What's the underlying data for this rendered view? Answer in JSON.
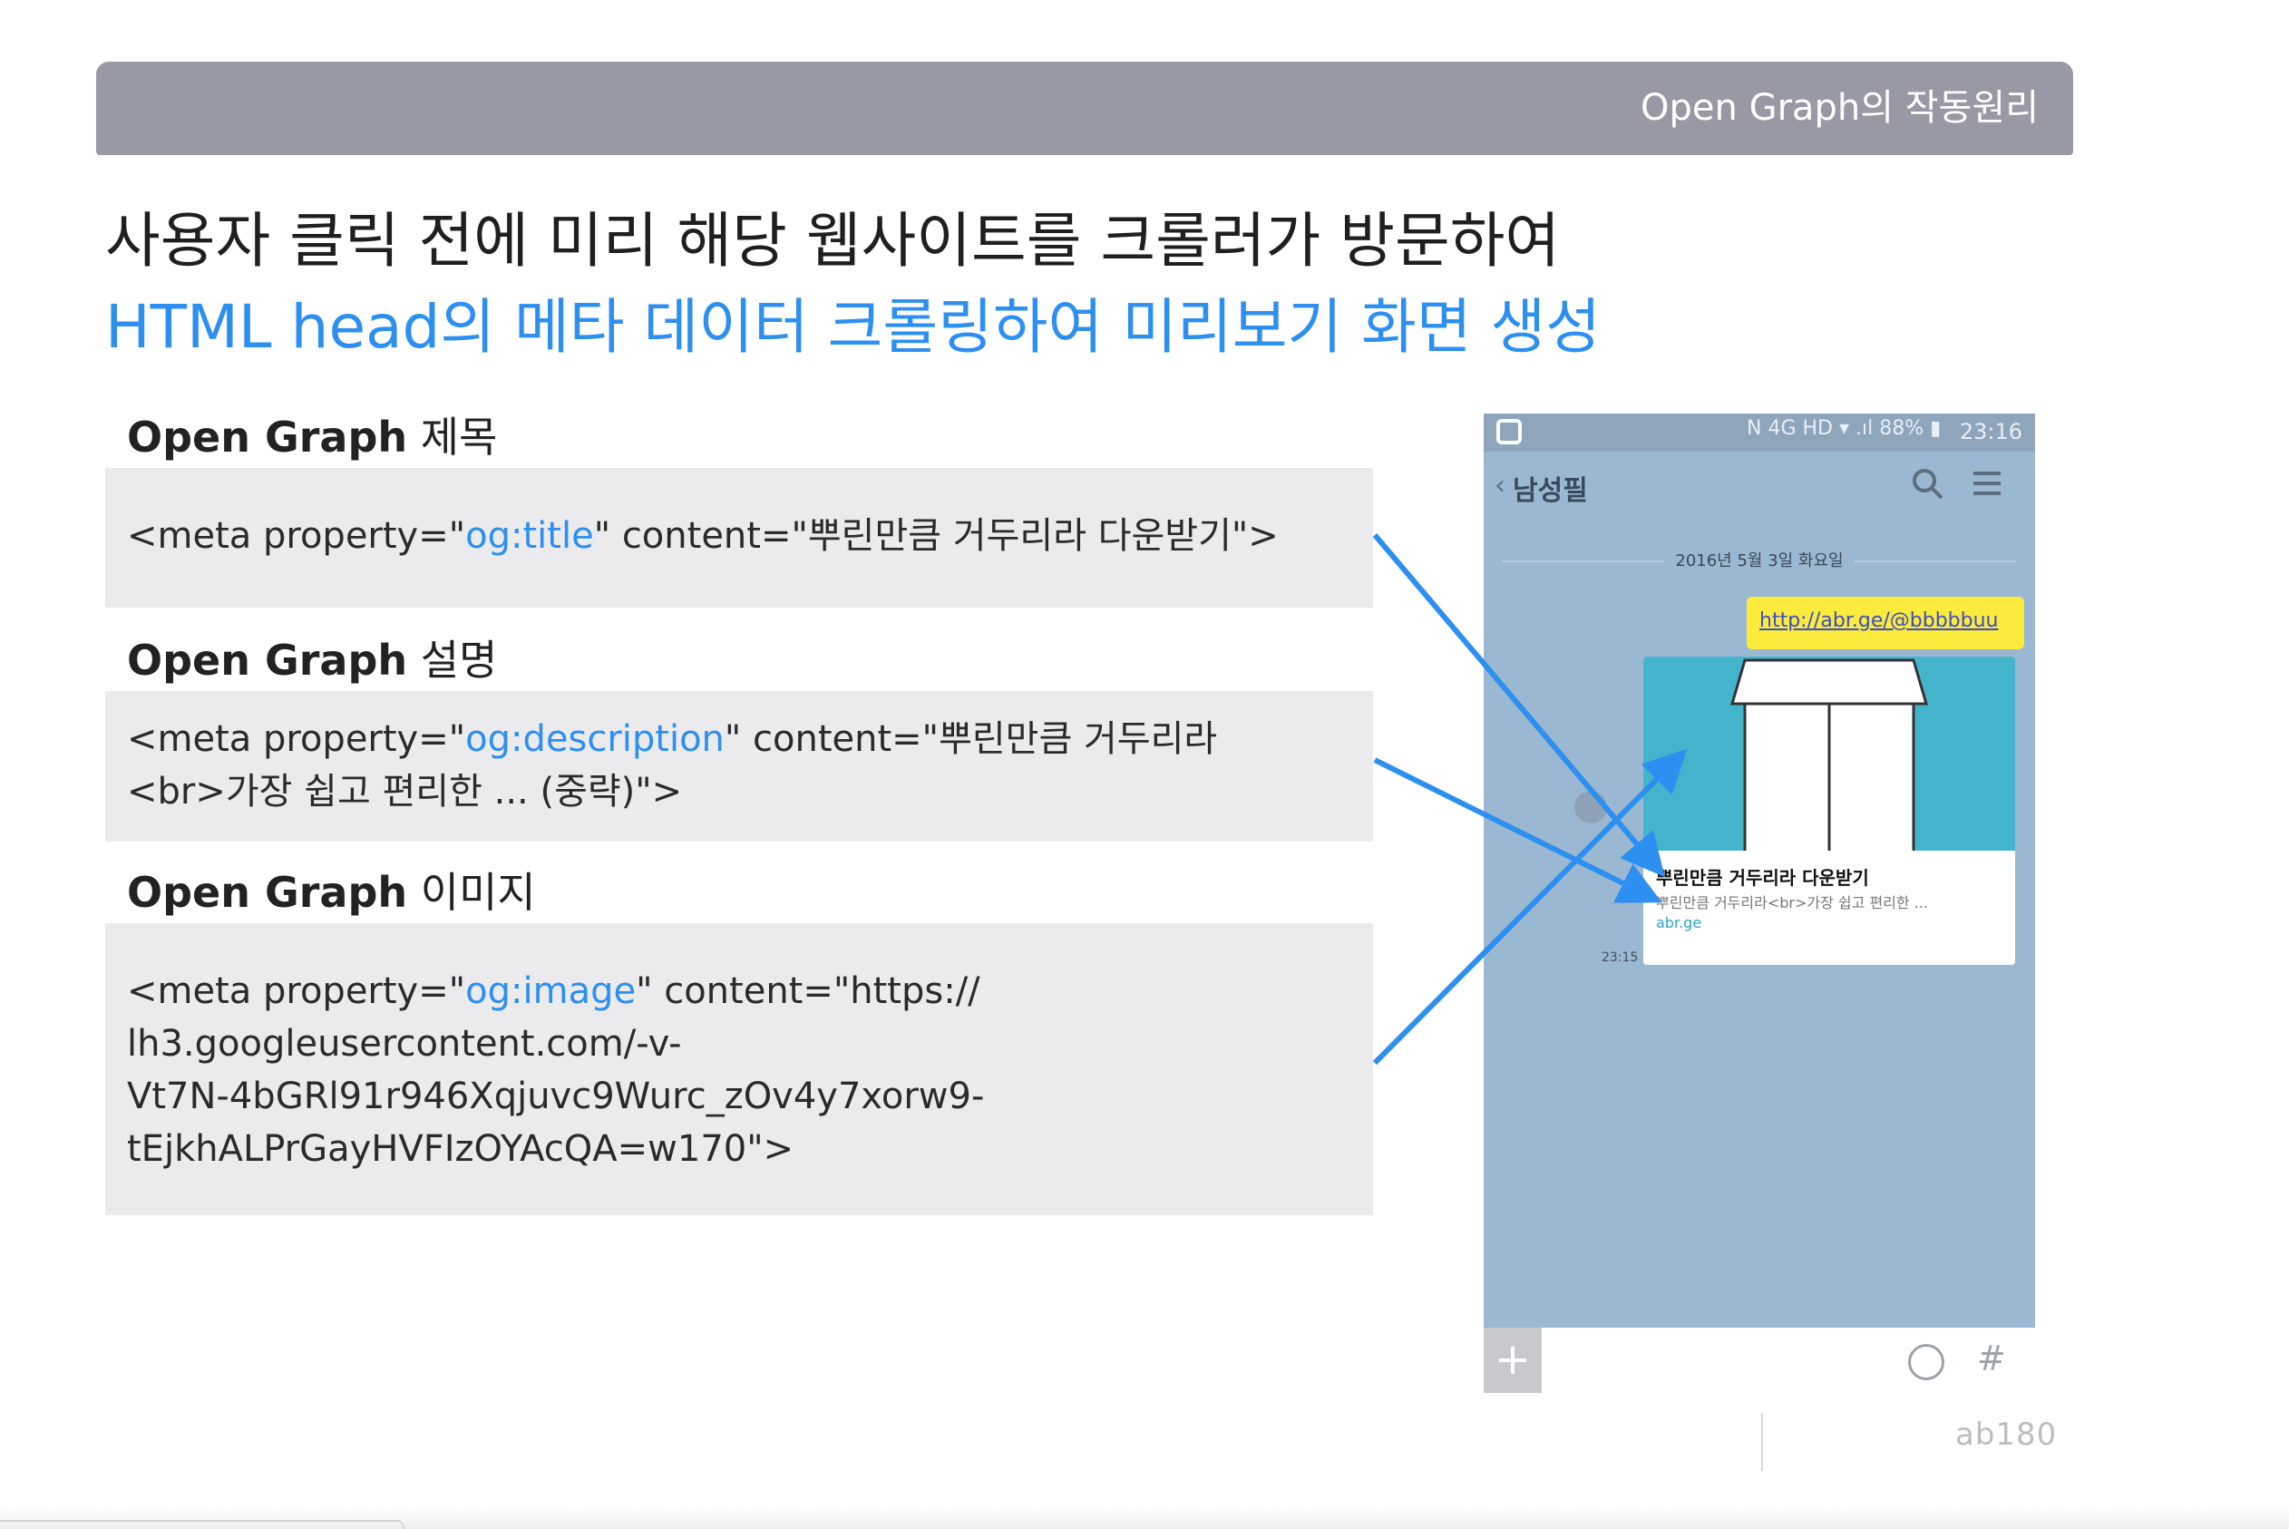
{
  "header": {
    "title": "Open Graph의 작동원리"
  },
  "headline": {
    "line1": "사용자 클릭 전에 미리 해당 웹사이트를 크롤러가 방문하여",
    "line2": "HTML head의 메타 데이터 크롤링하여 미리보기 화면 생성"
  },
  "sections": [
    {
      "label_bold": "Open Graph",
      "label_rest": " 제목",
      "code_prefix": "<meta property=\"",
      "property": "og:title",
      "code_lines": [
        "\" content=\"뿌린만큼 거두리라 다운받기\">"
      ]
    },
    {
      "label_bold": "Open Graph",
      "label_rest": " 설명",
      "code_prefix": "<meta property=\"",
      "property": "og:description",
      "code_lines": [
        "\" content=\"뿌린만큼 거두리라",
        "<br>가장 쉽고 편리한 ... (중략)\">"
      ]
    },
    {
      "label_bold": "Open Graph",
      "label_rest": " 이미지",
      "code_prefix": "<meta property=\"",
      "property": "og:image",
      "code_lines": [
        "\" content=\"https://",
        "lh3.googleusercontent.com/-v-",
        "Vt7N-4bGRl91r946Xqjuvc9Wurc_zOv4y7xorw9-",
        "tEjkhALPrGayHVFIzOYAcQA=w170\">"
      ]
    }
  ],
  "phone": {
    "status_icons": "N 4G HD  ▾  .ıl 88% ▮",
    "status_time": "23:16",
    "room_name": "남성필",
    "date": "2016년 5월 3일 화요일",
    "link": "http://abr.ge/@bbbbbuu",
    "card_title": "뿌린만큼 거두리라 다운받기",
    "card_desc": "뿌린만큼 거두리라<br>가장 쉽고 편리한 ...",
    "card_domain": "abr.ge",
    "msg_time": "23:15"
  },
  "footer": {
    "logo": "ab180"
  },
  "colors": {
    "accent": "#2d8ff0",
    "header_bar": "#979aa4",
    "chat_bg": "#9bb8d2",
    "bubble": "#fcea3d",
    "card_image": "#44b4cd"
  }
}
